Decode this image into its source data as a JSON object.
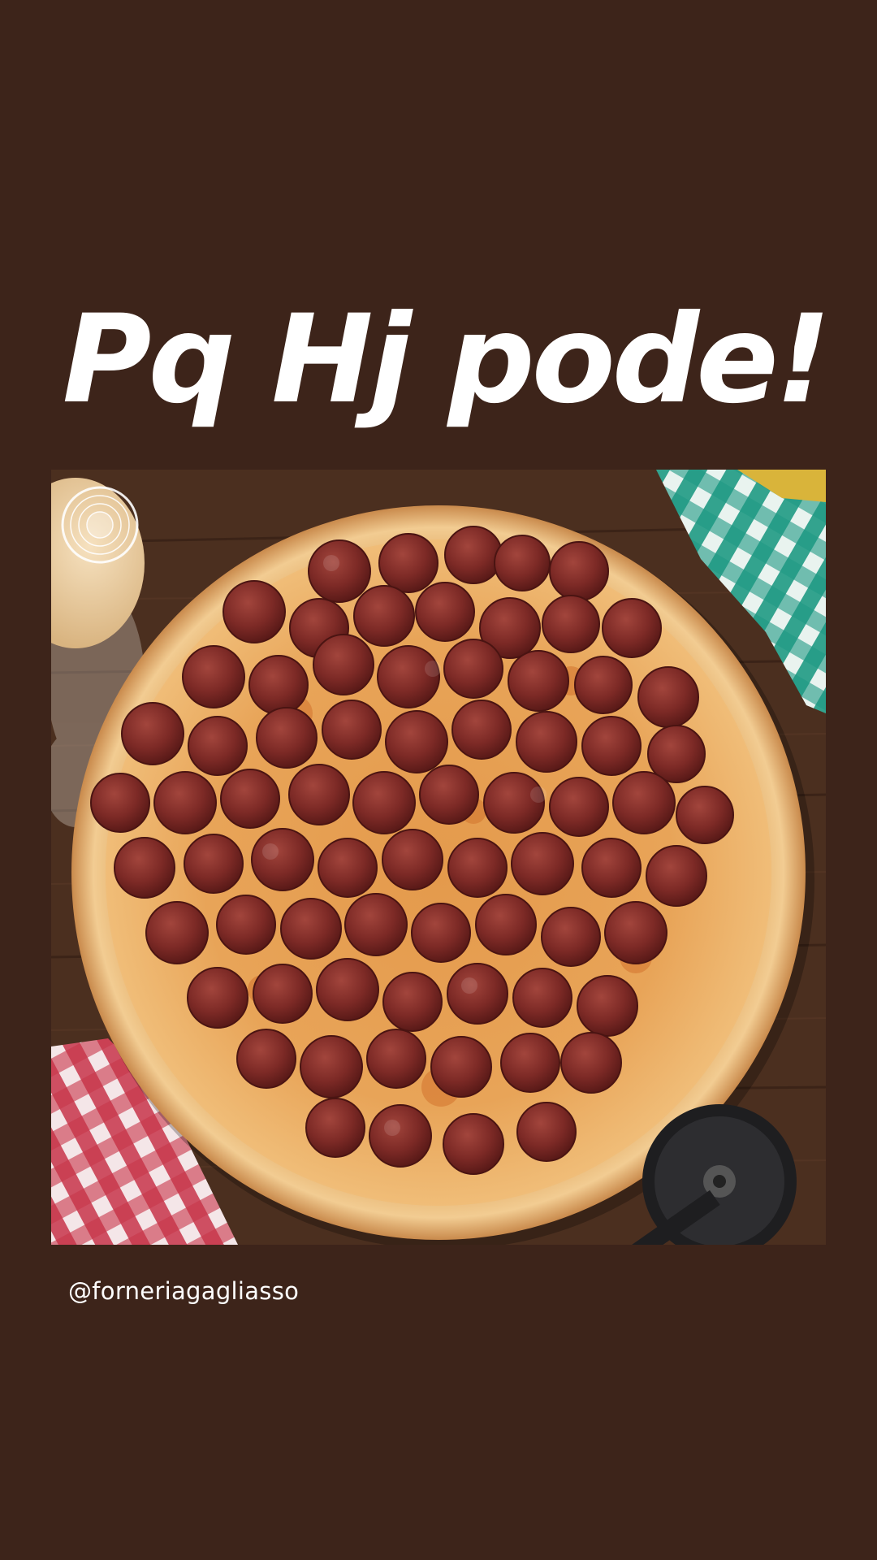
{
  "story": {
    "headline": "Pq Hj pode!",
    "mention": "@forneriagagliasso",
    "background_color": "#3d241a",
    "text_color": "#ffffff"
  },
  "photo": {
    "subject": "pepperoni pizza on wooden table",
    "elements": [
      "pizza",
      "dough-ball",
      "logo-stamp",
      "red-checkered-cloth",
      "green-checkered-cloth",
      "pizza-cutter",
      "flour"
    ]
  }
}
